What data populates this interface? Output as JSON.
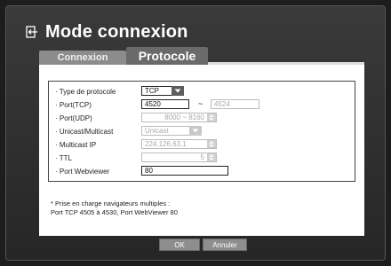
{
  "dialog": {
    "title": "Mode connexion",
    "icon": "exit-icon"
  },
  "tabs": [
    {
      "label": "Connexion",
      "selected": false
    },
    {
      "label": "Protocole",
      "selected": true
    }
  ],
  "form": {
    "protocol_type": {
      "label": "· Type de protocole",
      "value": "TCP"
    },
    "port_tcp": {
      "label": "· Port(TCP)",
      "value_start": "4520",
      "separator": "~",
      "value_end": "4524"
    },
    "port_udp": {
      "label": "· Port(UDP)",
      "value": "8000 ~ 8160"
    },
    "unicast_multicast": {
      "label": "· Unicast/Multicast",
      "value": "Unicast"
    },
    "multicast_ip": {
      "label": "· Multicast IP",
      "value": "224.126.63.1"
    },
    "ttl": {
      "label": "· TTL",
      "value": "5"
    },
    "port_webviewer": {
      "label": "· Port Webviewer",
      "value": "80"
    }
  },
  "note": {
    "line1": "* Prise en charge navigateurs multiples :",
    "line2": "Port TCP 4505 à 4530, Port WebViewer 80"
  },
  "buttons": {
    "ok": "OK",
    "cancel": "Annuler"
  },
  "colors": {
    "background": "#1d1d1d",
    "dialog": "#2e2e2e",
    "panel": "#ffffff",
    "dropdown_arrow": "#5e5e5e",
    "button": "#8e8e8e"
  }
}
